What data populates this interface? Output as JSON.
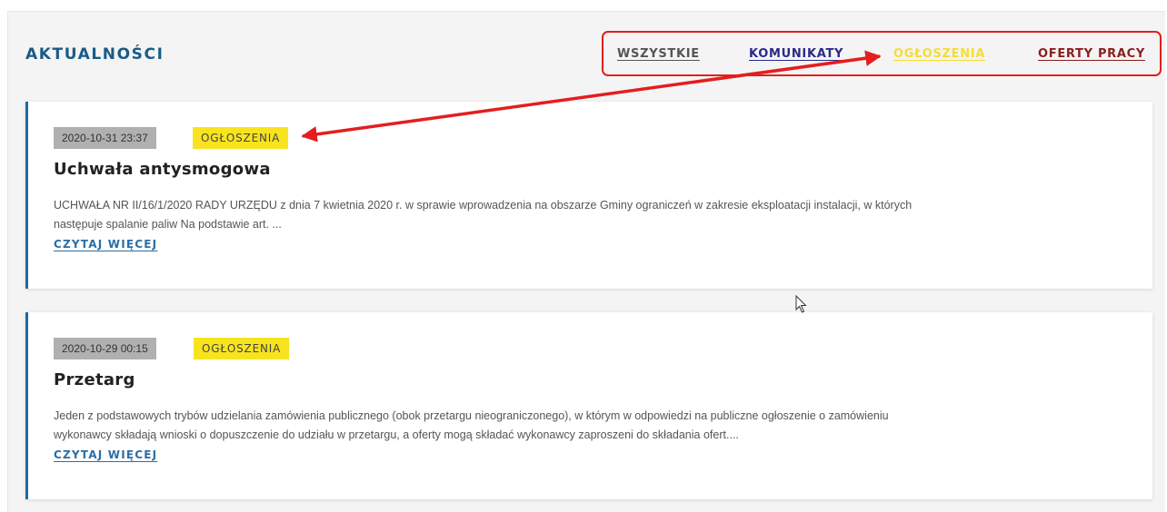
{
  "section": {
    "title": "AKTUALNOŚCI"
  },
  "filters": [
    {
      "label": "WSZYSTKIE",
      "color": "#555555"
    },
    {
      "label": "KOMUNIKATY",
      "color": "#2a2a8a"
    },
    {
      "label": "OGŁOSZENIA",
      "color": "#f5dd33"
    },
    {
      "label": "OFERTY PRACY",
      "color": "#8b1e1e"
    }
  ],
  "posts": [
    {
      "date": "2020-10-31 23:37",
      "category": "OGŁOSZENIA",
      "title": "Uchwała antysmogowa",
      "excerpt_line1": "UCHWAŁA NR II/16/1/2020 RADY URZĘDU z dnia 7 kwietnia 2020 r. w sprawie wprowadzenia na obszarze Gminy ograniczeń w zakresie eksploatacji instalacji, w których",
      "excerpt_line2": "następuje spalanie paliw   Na podstawie art. ...",
      "read_more": "CZYTAJ WIĘCEJ"
    },
    {
      "date": "2020-10-29 00:15",
      "category": "OGŁOSZENIA",
      "title": "Przetarg",
      "excerpt_line1": "Jeden z podstawowych trybów udzielania zamówienia publicznego (obok przetargu nieograniczonego), w którym w odpowiedzi na publiczne ogłoszenie o zamówieniu",
      "excerpt_line2": "wykonawcy składają wnioski o dopuszczenie do udziału w przetargu, a oferty mogą składać wykonawcy zaproszeni do składania ofert....",
      "read_more": "CZYTAJ WIĘCEJ"
    }
  ],
  "colors": {
    "accent_blue": "#1a5b86",
    "category_badge": "#f7e41f",
    "annotation_red": "#e41e1e"
  },
  "icons": [
    "mouse-cursor-icon"
  ]
}
